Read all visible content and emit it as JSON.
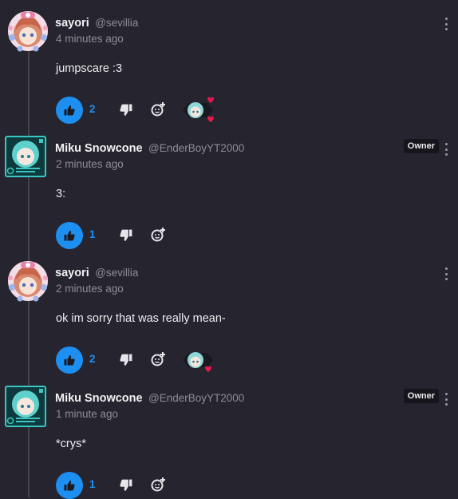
{
  "comments": [
    {
      "name": "sayori",
      "handle": "@sevillia",
      "time": "4 minutes ago",
      "text": "jumpscare :3",
      "likes": "2",
      "avatar": "sayori-avatar",
      "badge": "",
      "reaction": "miku-hearts"
    },
    {
      "name": "Miku Snowcone",
      "handle": "@EnderBoyYT2000",
      "time": "2 minutes ago",
      "text": "3:",
      "likes": "1",
      "avatar": "miku-avatar",
      "badge": "Owner",
      "reaction": ""
    },
    {
      "name": "sayori",
      "handle": "@sevillia",
      "time": "2 minutes ago",
      "text": "ok im sorry that was really mean-",
      "likes": "2",
      "avatar": "sayori-avatar",
      "badge": "",
      "reaction": "miku-heart"
    },
    {
      "name": "Miku Snowcone",
      "handle": "@EnderBoyYT2000",
      "time": "1 minute ago",
      "text": "*crys*",
      "likes": "1",
      "avatar": "miku-avatar",
      "badge": "Owner",
      "reaction": ""
    }
  ],
  "colors": {
    "background": "#26252f",
    "accent": "#1d8ff0",
    "muted": "#8d8c96",
    "heart": "#e8194d"
  }
}
